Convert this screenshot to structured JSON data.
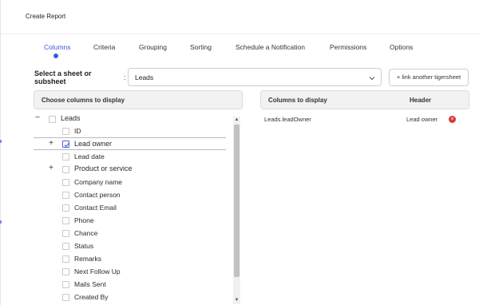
{
  "header": {
    "title": "Create Report"
  },
  "tabs": [
    {
      "label": "Columns",
      "active": true
    },
    {
      "label": "Criteria"
    },
    {
      "label": "Grouping"
    },
    {
      "label": "Sorting"
    },
    {
      "label": "Schedule a Notification"
    },
    {
      "label": "Permissions"
    },
    {
      "label": "Options"
    }
  ],
  "sheet_select": {
    "label": "Select a sheet or subsheet",
    "colon": ":",
    "value": "Leads",
    "link_button": "+ link another tigersheet"
  },
  "choose_panel": {
    "header": "Choose columns to display",
    "tree": {
      "root": {
        "label": "Leads",
        "expander": "−"
      },
      "items": [
        {
          "label": "ID"
        },
        {
          "label": "Lead owner",
          "checked": true,
          "expander": "+"
        },
        {
          "label": "Lead date"
        },
        {
          "label": "Product or service",
          "expander": "+"
        },
        {
          "label": "Company name"
        },
        {
          "label": "Contact person"
        },
        {
          "label": "Contact Email"
        },
        {
          "label": "Phone"
        },
        {
          "label": "Chance"
        },
        {
          "label": "Status"
        },
        {
          "label": "Remarks"
        },
        {
          "label": "Next Follow Up"
        },
        {
          "label": "Mails Sent"
        },
        {
          "label": "Created By"
        }
      ]
    },
    "scroll": {
      "up": "▲",
      "down": "▼"
    }
  },
  "display_panel": {
    "header_columns": "Columns to display",
    "header_header": "Header",
    "rows": [
      {
        "column": "Leads.leadOwner",
        "header": "Lead owner"
      }
    ]
  },
  "colors": {
    "accent": "#3b5bdb",
    "remove": "#d93a3a"
  }
}
